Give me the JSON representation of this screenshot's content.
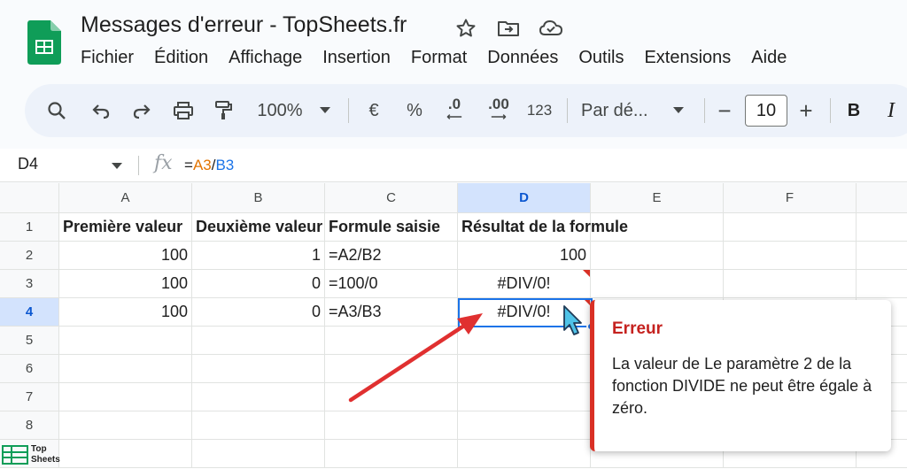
{
  "window": {
    "title": "Messages d'erreur - TopSheets.fr"
  },
  "menu": [
    "Fichier",
    "Édition",
    "Affichage",
    "Insertion",
    "Format",
    "Données",
    "Outils",
    "Extensions",
    "Aide"
  ],
  "toolbar": {
    "zoom": "100%",
    "currency": "€",
    "percent": "%",
    "dec_decrease": ".0",
    "dec_increase": ".00",
    "format_number": "123",
    "font_family": "Par dé...",
    "font_size": "10",
    "minus": "−",
    "plus": "+",
    "bold": "B",
    "italic": "I"
  },
  "formula_bar": {
    "cell_ref": "D4",
    "fx": "fx",
    "formula": {
      "eq": "=",
      "ref1": "A3",
      "slash": "/",
      "ref2": "B3"
    }
  },
  "grid": {
    "columns": [
      "A",
      "B",
      "C",
      "D",
      "E",
      "F"
    ],
    "rows": [
      "1",
      "2",
      "3",
      "4",
      "5",
      "6",
      "7",
      "8"
    ],
    "cells": [
      [
        "Première valeur",
        "Deuxième valeur",
        "Formule saisie",
        "Résultat de la formule",
        "",
        ""
      ],
      [
        "100",
        "1",
        "=A2/B2",
        "100",
        "",
        ""
      ],
      [
        "100",
        "0",
        "=100/0",
        "#DIV/0!",
        "",
        ""
      ],
      [
        "100",
        "0",
        "=A3/B3",
        "#DIV/0!",
        "",
        ""
      ]
    ]
  },
  "error_popup": {
    "title": "Erreur",
    "message": "La valeur de Le paramètre 2 de la fonction DIVIDE ne peut être égale à zéro."
  },
  "watermark": {
    "line1": "Top",
    "line2": "Sheets"
  },
  "colors": {
    "accent": "#1a73e8",
    "error": "#d93025",
    "sheets_green": "#0f9d58",
    "arrow": "#e03030"
  }
}
